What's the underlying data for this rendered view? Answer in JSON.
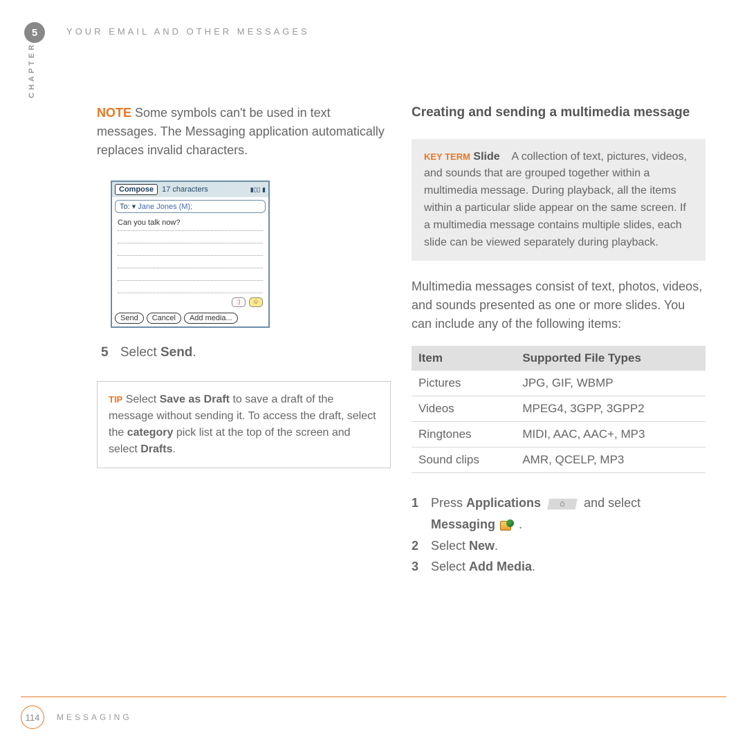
{
  "header": {
    "chapter_number": "5",
    "chapter_title": "YOUR EMAIL AND OTHER MESSAGES",
    "side_label": "CHAPTER"
  },
  "left_column": {
    "note_label": "NOTE",
    "note_text": "Some symbols can't be used in text messages. The Messaging application automatically replaces invalid characters.",
    "screenshot": {
      "compose_label": "Compose",
      "char_count": "17 characters",
      "to_label": "To:",
      "recipient": "Jane Jones (M);",
      "body_text": "Can you talk now?",
      "btn_send": "Send",
      "btn_cancel": "Cancel",
      "btn_addmedia": "Add media..."
    },
    "step5_num": "5",
    "step5_prefix": "Select ",
    "step5_bold": "Send",
    "step5_suffix": ".",
    "tip": {
      "label": "TIP",
      "t1": "Select ",
      "b1": "Save as Draft",
      "t2": " to save a draft of the message without sending it. To access the draft, select the ",
      "b2": "category",
      "t3": " pick list at the top of the screen and select ",
      "b3": "Drafts",
      "t4": "."
    }
  },
  "right_column": {
    "heading": "Creating and sending a multimedia message",
    "keyterm": {
      "label": "KEY TERM",
      "term": "Slide",
      "definition": "A collection of text, pictures, videos, and sounds that are grouped together within a multimedia message. During playback, all the items within a particular slide appear on the same screen. If a multimedia message contains multiple slides, each slide can be viewed separately during playback."
    },
    "intro": "Multimedia messages consist of text, photos, videos, and sounds presented as one or more slides. You can include any of the following items:",
    "table": {
      "head_item": "Item",
      "head_types": "Supported File Types",
      "rows": [
        {
          "item": "Pictures",
          "types": "JPG, GIF, WBMP"
        },
        {
          "item": "Videos",
          "types": "MPEG4, 3GPP, 3GPP2"
        },
        {
          "item": "Ringtones",
          "types": "MIDI, AAC, AAC+, MP3"
        },
        {
          "item": "Sound clips",
          "types": "AMR, QCELP, MP3"
        }
      ]
    },
    "steps": {
      "s1_num": "1",
      "s1_t1": "Press ",
      "s1_b1": "Applications",
      "s1_t2": " and select ",
      "s1_b2": "Messaging",
      "s1_suffix": " .",
      "s2_num": "2",
      "s2_t1": "Select ",
      "s2_b1": "New",
      "s2_suffix": ".",
      "s3_num": "3",
      "s3_t1": "Select ",
      "s3_b1": "Add Media",
      "s3_suffix": "."
    }
  },
  "footer": {
    "page_number": "114",
    "section": "MESSAGING"
  }
}
